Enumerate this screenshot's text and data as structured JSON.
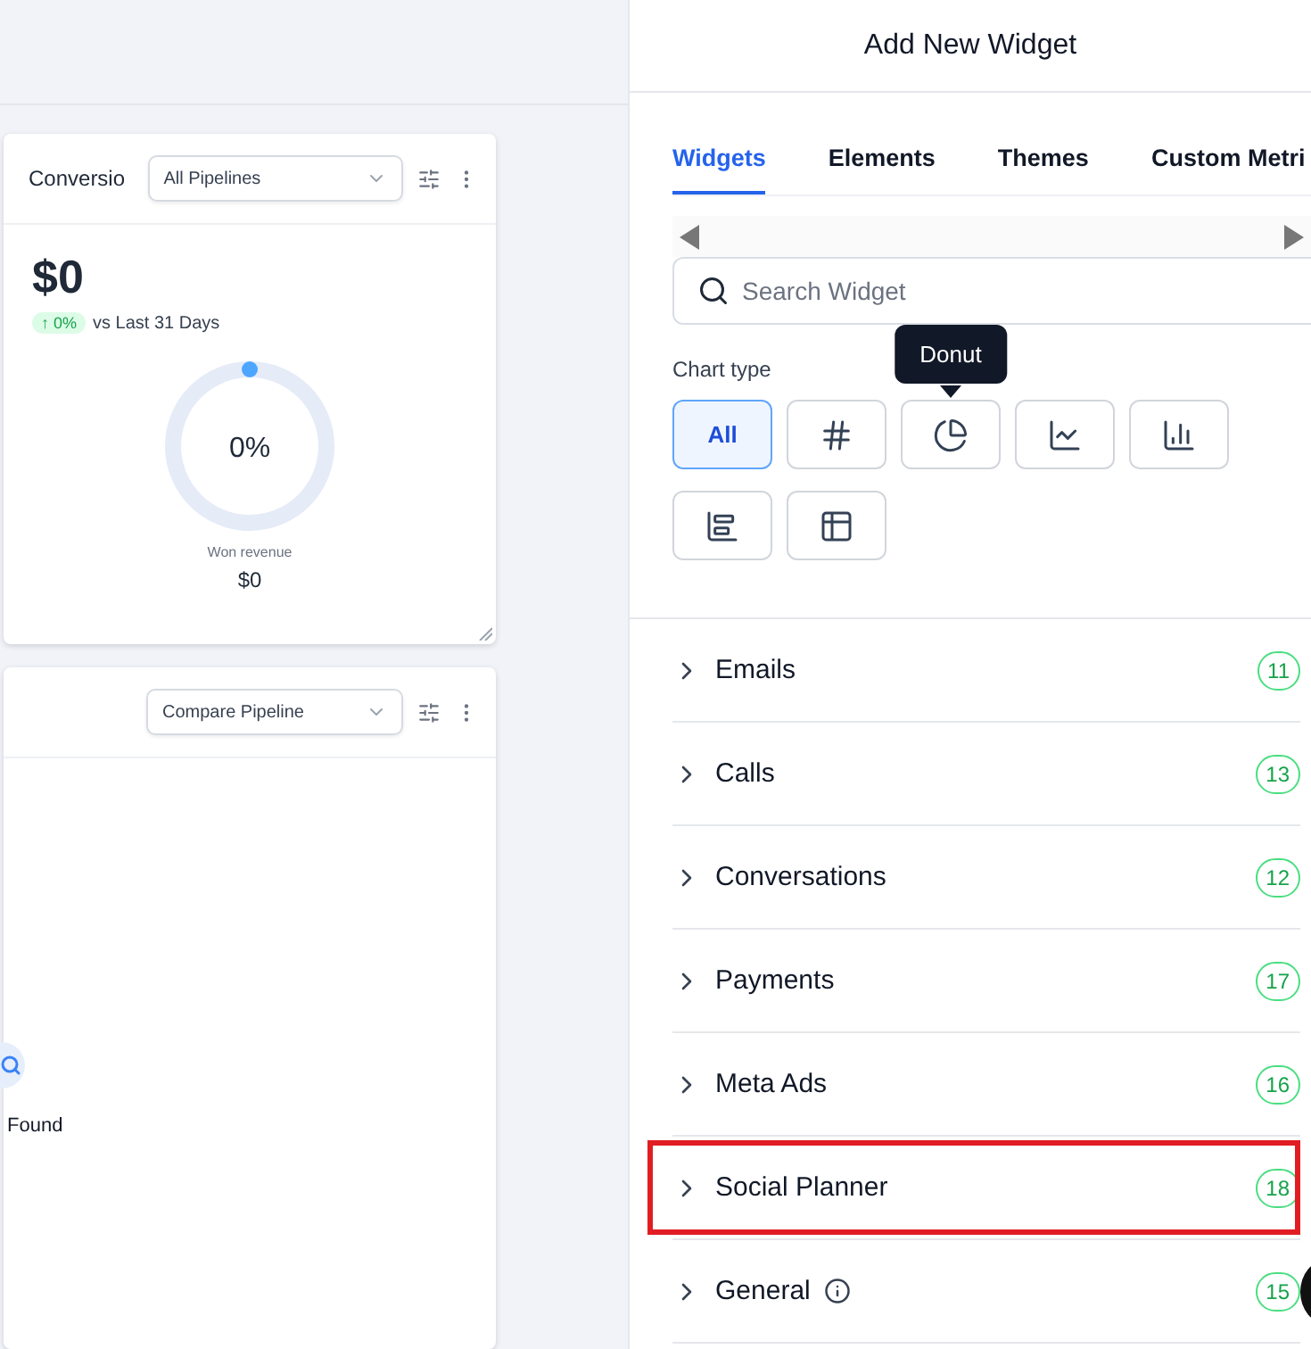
{
  "dashboard": {
    "widgets": [
      {
        "kind": "donut",
        "title": "Conversio",
        "dropdown": "All Pipelines",
        "value": "$0",
        "change": "↑ 0%",
        "comparison": "vs Last 31 Days",
        "center_label": "0%",
        "caption": "Won revenue",
        "caption_value": "$0"
      },
      {
        "kind": "empty",
        "dropdown": "Compare Pipeline",
        "empty_text": "Found"
      }
    ]
  },
  "panel": {
    "title": "Add New Widget",
    "tabs": [
      {
        "label": "Widgets",
        "selected": true
      },
      {
        "label": "Elements",
        "selected": false
      },
      {
        "label": "Themes",
        "selected": false
      },
      {
        "label": "Custom Metri",
        "selected": false
      }
    ],
    "search": {
      "placeholder": "Search Widget"
    },
    "chart_type_label": "Chart type",
    "chart_types": [
      {
        "kind": "all",
        "label": "All",
        "selected": true
      },
      {
        "kind": "number",
        "selected": false
      },
      {
        "kind": "donut",
        "selected": false,
        "tooltip": "Donut"
      },
      {
        "kind": "line",
        "selected": false
      },
      {
        "kind": "bar",
        "selected": false
      },
      {
        "kind": "hbar",
        "selected": false
      },
      {
        "kind": "table",
        "selected": false
      }
    ],
    "categories": [
      {
        "name": "Emails",
        "count": "11",
        "info": false,
        "highlighted": false
      },
      {
        "name": "Calls",
        "count": "13",
        "info": false,
        "highlighted": false
      },
      {
        "name": "Conversations",
        "count": "12",
        "info": false,
        "highlighted": false
      },
      {
        "name": "Payments",
        "count": "17",
        "info": false,
        "highlighted": false
      },
      {
        "name": "Meta Ads",
        "count": "16",
        "info": false,
        "highlighted": false
      },
      {
        "name": "Social Planner",
        "count": "18",
        "info": false,
        "highlighted": true
      },
      {
        "name": "General",
        "count": "15",
        "info": true,
        "highlighted": false
      }
    ]
  }
}
